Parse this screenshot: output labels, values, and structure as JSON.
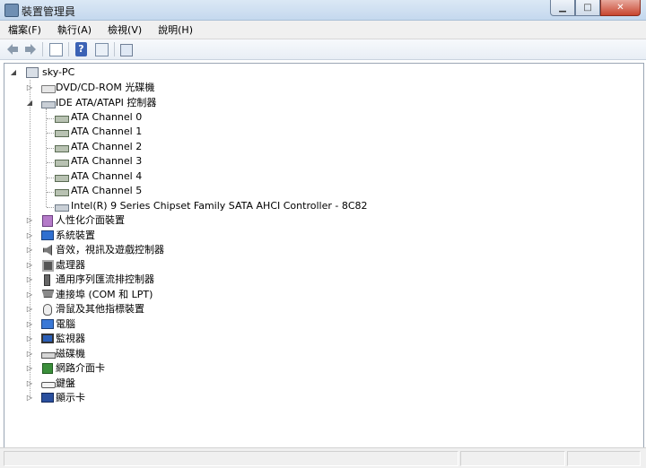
{
  "window": {
    "title": "裝置管理員"
  },
  "menu": [
    "檔案(F)",
    "執行(A)",
    "檢視(V)",
    "說明(H)"
  ],
  "tree": {
    "root": "sky-PC",
    "categories": [
      {
        "label": "DVD/CD-ROM 光碟機",
        "icon": "dvd-drive-icon",
        "expanded": false
      },
      {
        "label": "IDE ATA/ATAPI 控制器",
        "icon": "ide-controller-icon",
        "expanded": true,
        "children": [
          "ATA Channel 0",
          "ATA Channel 1",
          "ATA Channel 2",
          "ATA Channel 3",
          "ATA Channel 4",
          "ATA Channel 5",
          "Intel(R) 9 Series Chipset Family SATA AHCI Controller  - 8C82"
        ]
      },
      {
        "label": "人性化介面裝置",
        "icon": "hid-icon",
        "expanded": false
      },
      {
        "label": "系統裝置",
        "icon": "system-device-icon",
        "expanded": false
      },
      {
        "label": "音效，視訊及遊戲控制器",
        "icon": "sound-icon",
        "expanded": false
      },
      {
        "label": "處理器",
        "icon": "processor-icon",
        "expanded": false
      },
      {
        "label": "通用序列匯流排控制器",
        "icon": "usb-icon",
        "expanded": false
      },
      {
        "label": "連接埠 (COM 和 LPT)",
        "icon": "port-icon",
        "expanded": false
      },
      {
        "label": "滑鼠及其他指標裝置",
        "icon": "mouse-icon",
        "expanded": false
      },
      {
        "label": "電腦",
        "icon": "computer-icon",
        "expanded": false
      },
      {
        "label": "監視器",
        "icon": "monitor-icon",
        "expanded": false
      },
      {
        "label": "磁碟機",
        "icon": "disk-drive-icon",
        "expanded": false
      },
      {
        "label": "網路介面卡",
        "icon": "network-adapter-icon",
        "expanded": false
      },
      {
        "label": "鍵盤",
        "icon": "keyboard-icon",
        "expanded": false
      },
      {
        "label": "顯示卡",
        "icon": "display-adapter-icon",
        "expanded": false
      }
    ]
  }
}
